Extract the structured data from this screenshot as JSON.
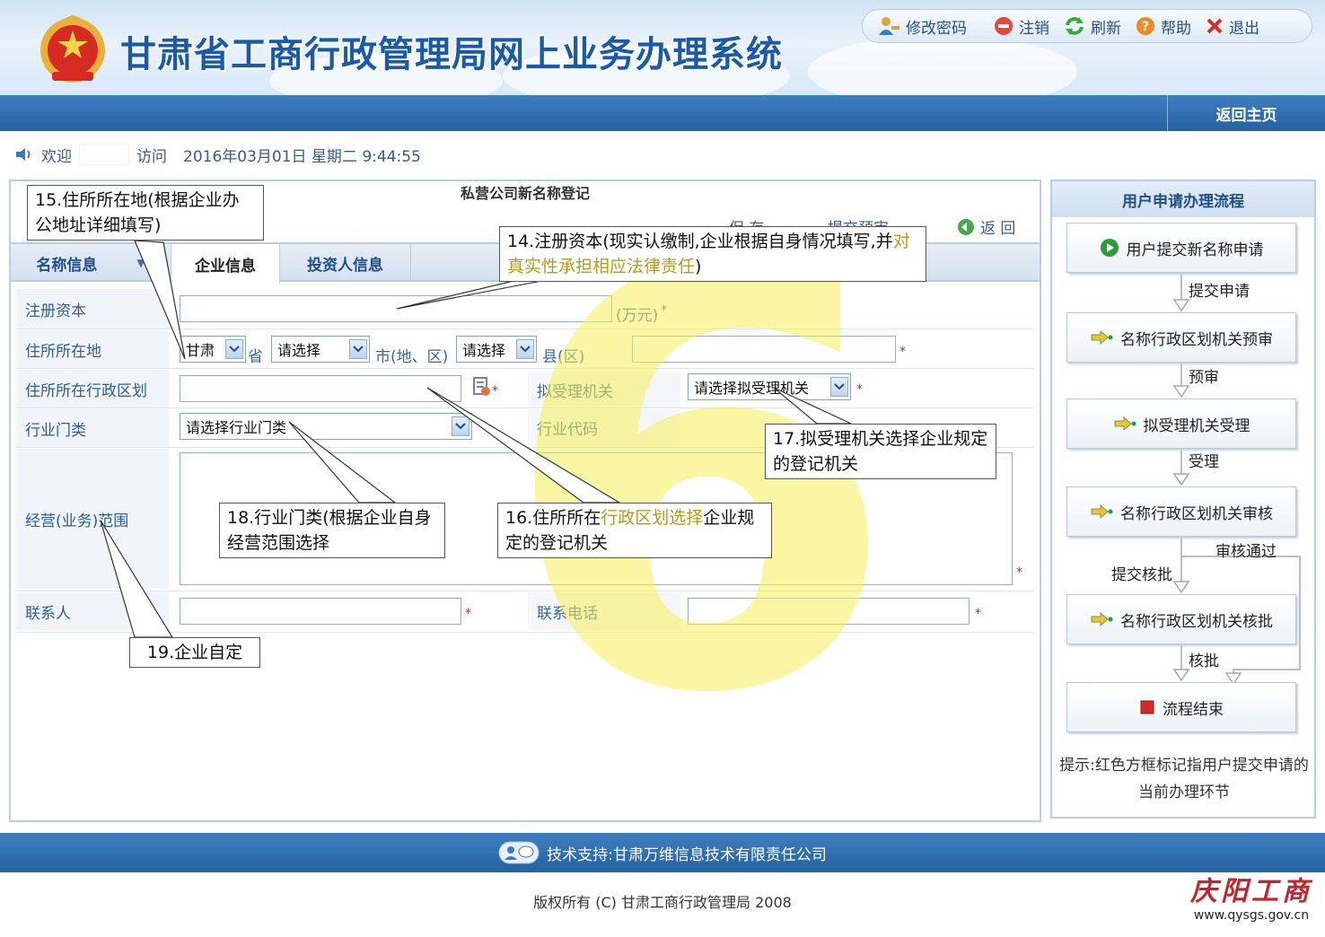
{
  "header": {
    "title": "甘肃省工商行政管理局网上业务办理系统",
    "toolbar": {
      "change_password": "修改密码",
      "logout": "注销",
      "refresh": "刷新",
      "help": "帮助",
      "exit": "退出"
    }
  },
  "nav": {
    "home": "返回主页"
  },
  "welcome": {
    "greeting": "欢迎",
    "visit": "访问",
    "datetime": "2016年03月01日 星期二 9:44:55"
  },
  "form": {
    "title": "私营公司新名称登记",
    "actions": {
      "save": "保 存",
      "submit": "提交预审",
      "back": "返 回"
    },
    "tabs": {
      "name_info": "名称信息",
      "company_info": "企业信息",
      "investor_info": "投资人信息"
    },
    "fields": {
      "registered_capital": {
        "label": "注册资本",
        "unit": "(万元)"
      },
      "address": {
        "label": "住所所在地",
        "province": "甘肃",
        "province_suffix": "省",
        "city": "请选择",
        "city_suffix": "市(地、区)",
        "county": "请选择",
        "county_suffix": "县(区)"
      },
      "admin_division": {
        "label": "住所所在行政区划"
      },
      "acceptance_authority": {
        "label": "拟受理机关",
        "value": "请选择拟受理机关"
      },
      "industry_category": {
        "label": "行业门类",
        "value": "请选择行业门类"
      },
      "industry_code": {
        "label": "行业代码"
      },
      "business_scope": {
        "label": "经营(业务)范围"
      },
      "contact": {
        "label": "联系人"
      },
      "phone": {
        "label": "联系电话"
      }
    },
    "required_mark": "*"
  },
  "watermark": "6",
  "callouts": {
    "c15": "15.住所所在地(根据企业办公地址详细填写)",
    "c14": "14.注册资本(现实认缴制,企业根据自身情况填写,并",
    "c14_hl": "对真实性承担相应法律责任",
    "c14_end": ")",
    "c17": "17.拟受理机关选择企业规定的登记机关",
    "c18": "18.行业门类(根据企业自身经营范围选择",
    "c16_a": "16.住所所在",
    "c16_hl": "行政区划选择",
    "c16_b": "企业规定的登记机关",
    "c19": "19.企业自定"
  },
  "flow": {
    "title": "用户申请办理流程",
    "steps": [
      "用户提交新名称申请",
      "名称行政区划机关预审",
      "拟受理机关受理",
      "名称行政区划机关审核",
      "名称行政区划机关核批",
      "流程结束"
    ],
    "transitions": {
      "submit": "提交申请",
      "pre_review": "预审",
      "accept": "受理",
      "review_pass": "审核通过",
      "submit_approval": "提交核批",
      "approve": "核批"
    },
    "tip": "提示:红色方框标记指用户提交申请的当前办理环节"
  },
  "footer": {
    "support": "技术支持:甘肃万维信息技术有限责任公司",
    "copyright": "版权所有 (C) 甘肃工商行政管理局 2008"
  },
  "corner": {
    "brand": "庆阳工商",
    "url": "www.qysgs.gov.cn"
  },
  "colors": {
    "primary_blue": "#2461a3",
    "title_blue": "#1a5aa6",
    "required_red": "#e21a1a",
    "watermark_yellow": "#f6f05a"
  }
}
